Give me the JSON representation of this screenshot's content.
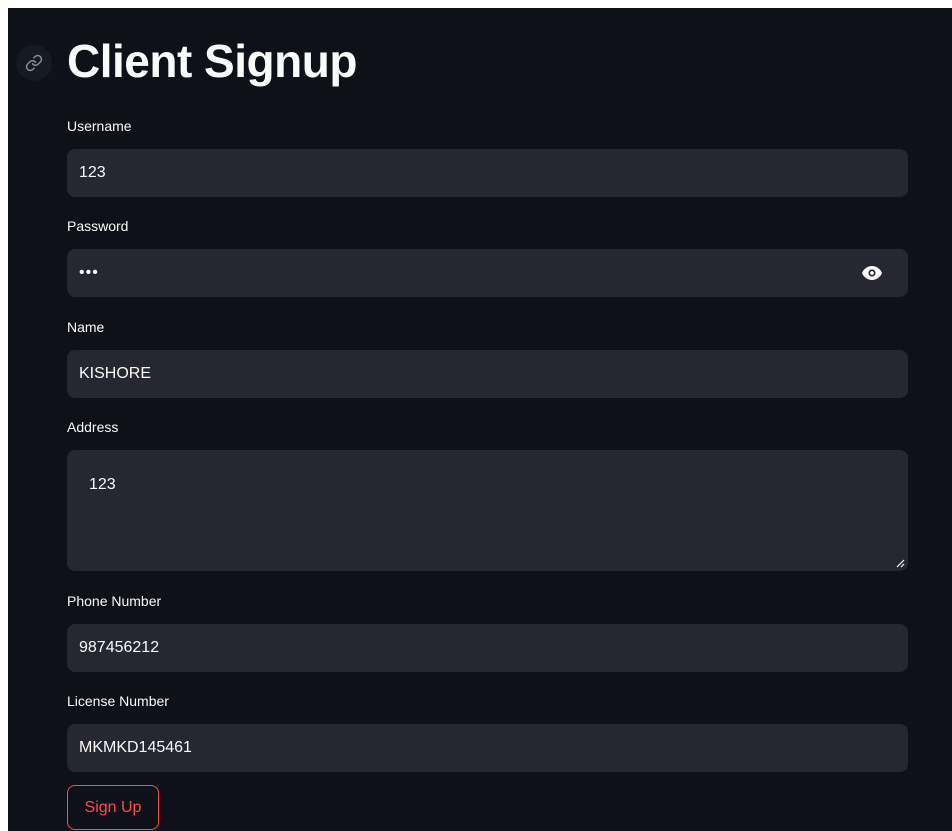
{
  "page": {
    "title": "Client Signup",
    "link_icon": "link-icon"
  },
  "form": {
    "username": {
      "label": "Username",
      "value": "123"
    },
    "password": {
      "label": "Password",
      "value": "•••",
      "toggle_icon": "eye-icon"
    },
    "name": {
      "label": "Name",
      "value": "KISHORE"
    },
    "address": {
      "label": "Address",
      "value": "123"
    },
    "phone": {
      "label": "Phone Number",
      "value": "987456212"
    },
    "license": {
      "label": "License Number",
      "value": "MKMKD145461"
    },
    "submit_label": "Sign Up"
  },
  "colors": {
    "background": "#0e1117",
    "input_background": "#262730",
    "text": "#fafafa",
    "accent": "#ff4b4b"
  }
}
